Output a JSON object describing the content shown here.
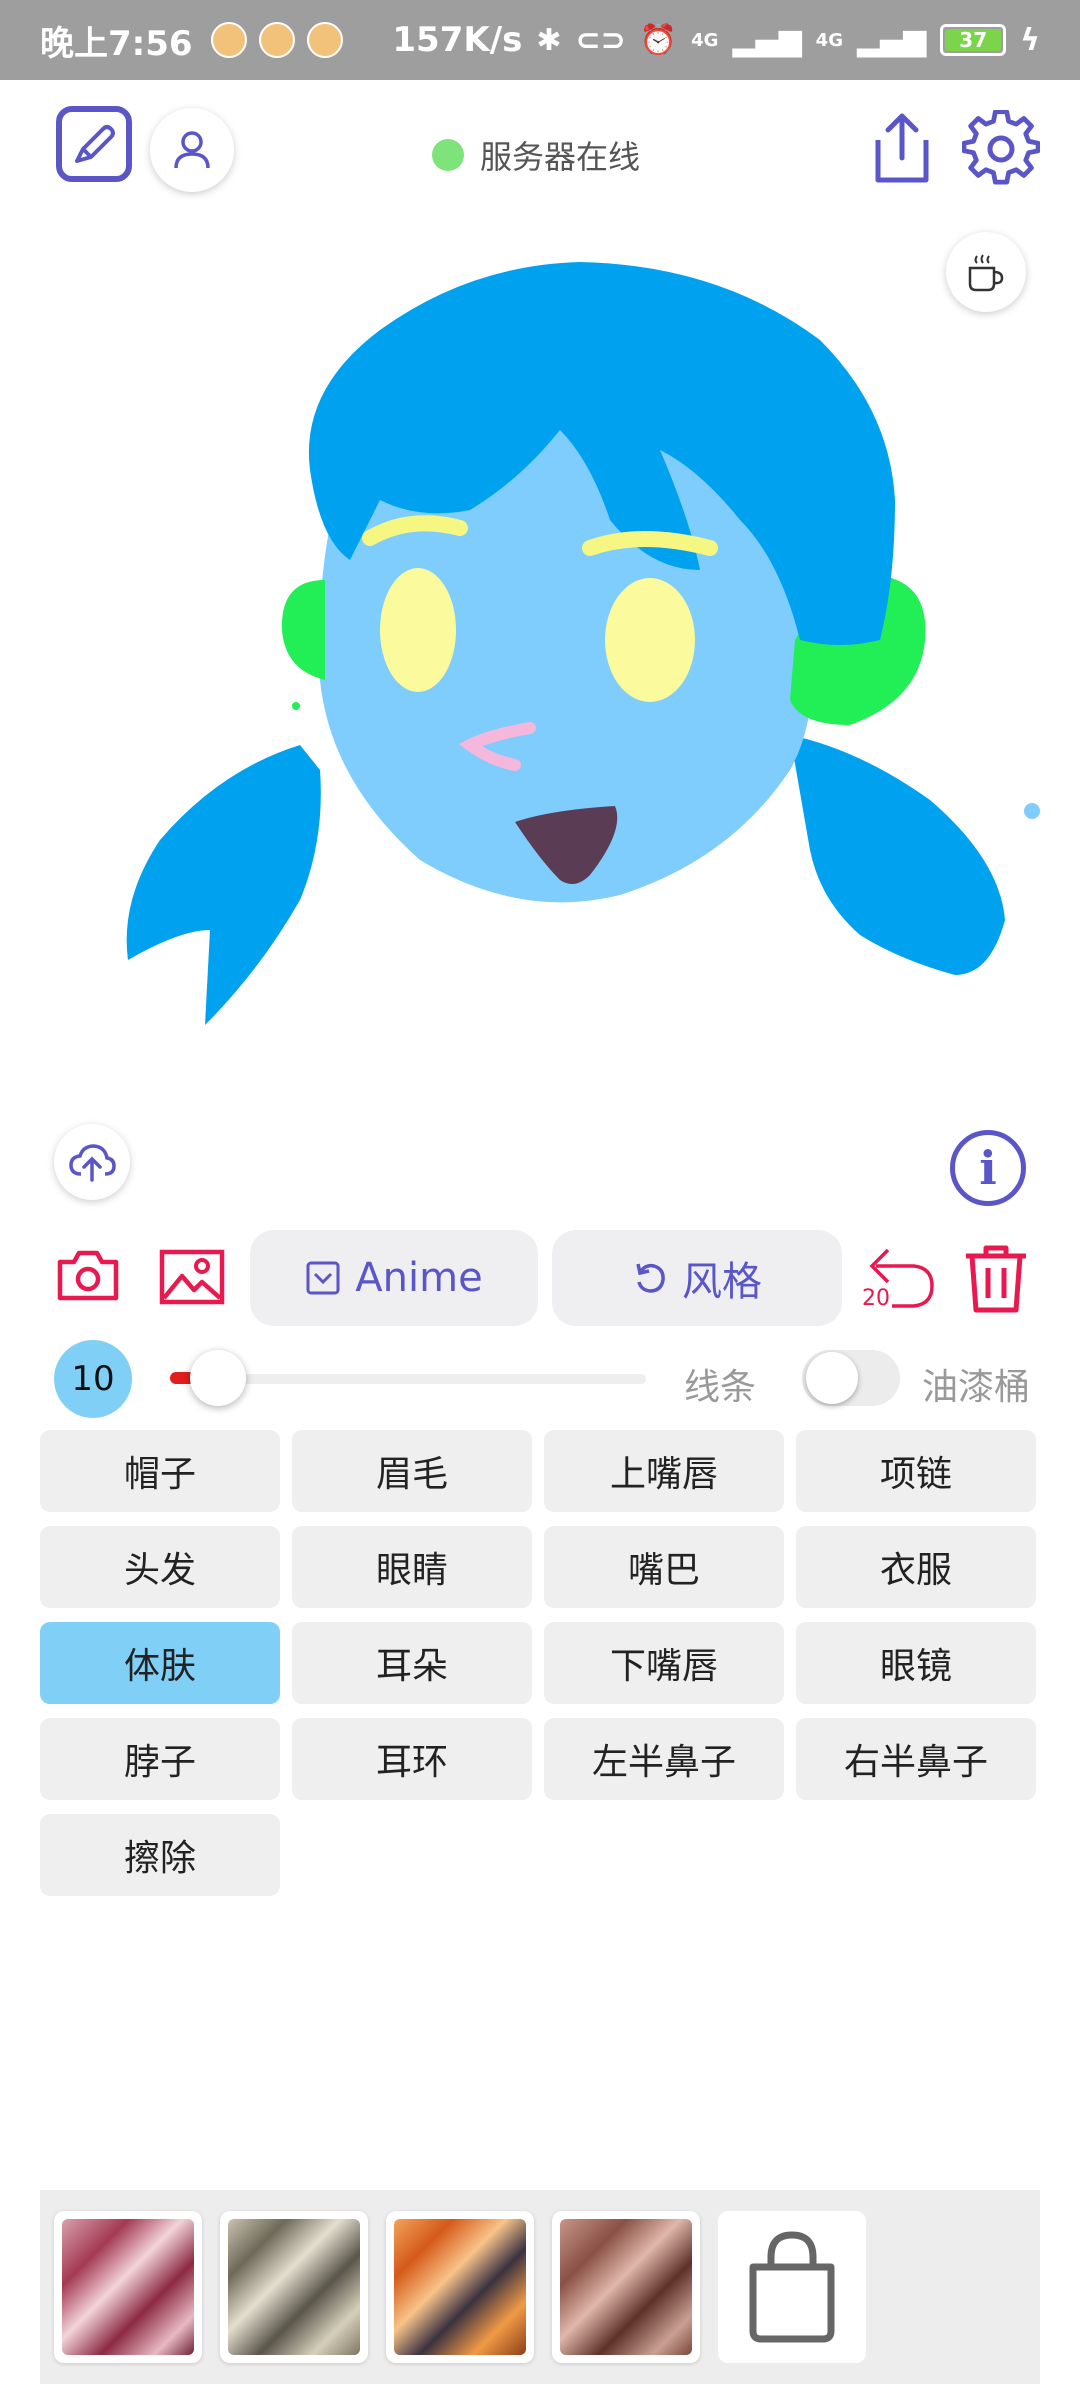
{
  "status_bar": {
    "time": "晚上7:56",
    "network_speed": "157K/s",
    "network_type_1": "4G",
    "network_type_2": "4G",
    "battery": "37"
  },
  "header": {
    "server_status": "服务器在线"
  },
  "toolbar": {
    "anime_label": "Anime",
    "style_label": "风格",
    "undo_count": "20"
  },
  "brush": {
    "size": "10",
    "size_fraction": 0.1,
    "line_label": "线条",
    "bucket_label": "油漆桶",
    "bucket_enabled": false
  },
  "parts": [
    "帽子",
    "眉毛",
    "上嘴唇",
    "项链",
    "头发",
    "眼睛",
    "嘴巴",
    "衣服",
    "体肤",
    "耳朵",
    "下嘴唇",
    "眼镜",
    "脖子",
    "耳环",
    "左半鼻子",
    "右半鼻子",
    "擦除"
  ],
  "selected_part": "体肤",
  "colors": {
    "accent": "#5a56c8",
    "danger": "#e8194f",
    "selected": "#7fcff7",
    "online": "#7ee37a"
  }
}
